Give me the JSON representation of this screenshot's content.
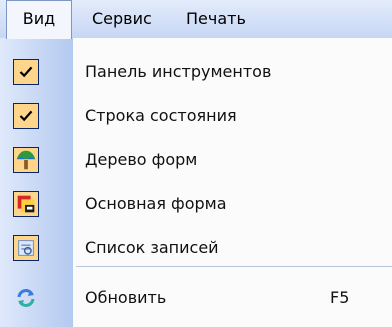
{
  "menubar": {
    "items": [
      {
        "label": "Вид"
      },
      {
        "label": "Сервис"
      },
      {
        "label": "Печать"
      }
    ]
  },
  "menu": {
    "items": [
      {
        "label": "Панель инструментов",
        "icon": "checkmark-icon",
        "checked": true
      },
      {
        "label": "Строка состояния",
        "icon": "checkmark-icon",
        "checked": true
      },
      {
        "label": "Дерево форм",
        "icon": "tree-icon",
        "checked": true
      },
      {
        "label": "Основная форма",
        "icon": "main-form-icon",
        "checked": true
      },
      {
        "label": "Список записей",
        "icon": "record-list-icon",
        "checked": true
      },
      {
        "label": "Обновить",
        "icon": "refresh-icon",
        "shortcut": "F5"
      }
    ]
  },
  "colors": {
    "menubar": "#c6d6f4",
    "gutter": "#b3c9ef",
    "checked_bg": "#fdd58b",
    "checked_border": "#0a246a"
  }
}
